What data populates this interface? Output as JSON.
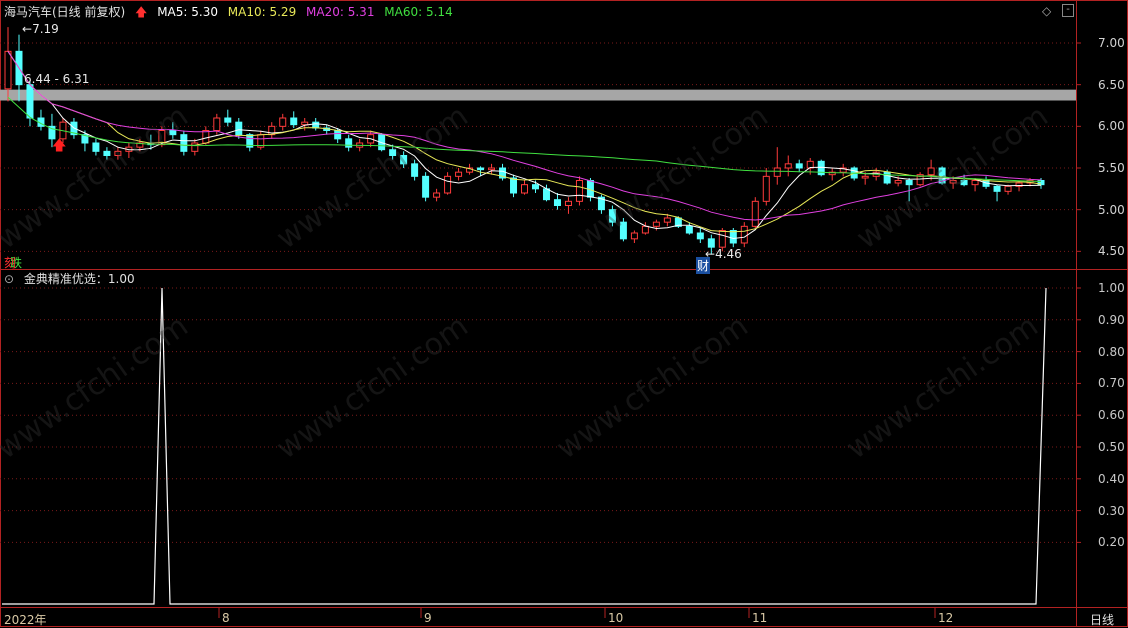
{
  "header": {
    "stock": "海马汽车(日线 前复权)",
    "ma5": "MA5: 5.30",
    "ma10": "MA10: 5.29",
    "ma20": "MA20: 5.31",
    "ma60": "MA60: 5.14",
    "indicator": "金典精准优选：1.00",
    "period": "日线"
  },
  "annotations": {
    "high": "7.19",
    "band": "6.44 - 6.31",
    "low": "4.46",
    "low_tag": "财",
    "left_tag": "跌"
  },
  "watermark": "www.cfchi.com",
  "chart_data": [
    {
      "type": "candlestick",
      "title": "海马汽车(日线 前复权)",
      "y_ticks": [
        "7.00",
        "6.50",
        "6.00",
        "5.50",
        "5.00",
        "4.50"
      ],
      "ylim": [
        4.3,
        7.3
      ],
      "x_ticks": [
        "2022年",
        "8",
        "9",
        "10",
        "11",
        "12"
      ],
      "support_band": [
        6.31,
        6.44
      ],
      "series": [
        {
          "name": "MA5",
          "color": "#ffffff"
        },
        {
          "name": "MA10",
          "color": "#e8e858"
        },
        {
          "name": "MA20",
          "color": "#e040e0"
        },
        {
          "name": "MA60",
          "color": "#40e040"
        }
      ],
      "candles": [
        [
          6.45,
          7.19,
          6.3,
          6.9
        ],
        [
          6.9,
          7.1,
          6.3,
          6.5
        ],
        [
          6.5,
          6.55,
          6.0,
          6.1
        ],
        [
          6.1,
          6.2,
          5.95,
          6.0
        ],
        [
          6.0,
          6.15,
          5.75,
          5.85
        ],
        [
          5.85,
          6.1,
          5.8,
          6.05
        ],
        [
          6.05,
          6.1,
          5.85,
          5.9
        ],
        [
          5.9,
          5.95,
          5.7,
          5.8
        ],
        [
          5.8,
          5.85,
          5.65,
          5.7
        ],
        [
          5.7,
          5.75,
          5.6,
          5.65
        ],
        [
          5.65,
          5.75,
          5.6,
          5.7
        ],
        [
          5.7,
          5.8,
          5.62,
          5.75
        ],
        [
          5.75,
          5.85,
          5.7,
          5.8
        ],
        [
          5.8,
          5.9,
          5.72,
          5.78
        ],
        [
          5.78,
          6.0,
          5.75,
          5.95
        ],
        [
          5.95,
          6.05,
          5.85,
          5.9
        ],
        [
          5.9,
          5.95,
          5.65,
          5.7
        ],
        [
          5.7,
          5.85,
          5.65,
          5.8
        ],
        [
          5.8,
          6.0,
          5.78,
          5.95
        ],
        [
          5.95,
          6.15,
          5.9,
          6.1
        ],
        [
          6.1,
          6.2,
          6.0,
          6.05
        ],
        [
          6.05,
          6.1,
          5.85,
          5.9
        ],
        [
          5.9,
          5.92,
          5.7,
          5.75
        ],
        [
          5.75,
          5.95,
          5.72,
          5.9
        ],
        [
          5.9,
          6.05,
          5.85,
          6.0
        ],
        [
          6.0,
          6.15,
          5.95,
          6.1
        ],
        [
          6.1,
          6.18,
          5.98,
          6.02
        ],
        [
          6.02,
          6.1,
          5.95,
          6.05
        ],
        [
          6.05,
          6.1,
          5.95,
          5.98
        ],
        [
          5.98,
          6.02,
          5.9,
          5.95
        ],
        [
          5.95,
          5.98,
          5.8,
          5.85
        ],
        [
          5.85,
          5.9,
          5.7,
          5.75
        ],
        [
          5.75,
          5.85,
          5.7,
          5.8
        ],
        [
          5.8,
          5.95,
          5.75,
          5.9
        ],
        [
          5.9,
          5.92,
          5.7,
          5.72
        ],
        [
          5.72,
          5.78,
          5.6,
          5.65
        ],
        [
          5.65,
          5.7,
          5.5,
          5.55
        ],
        [
          5.55,
          5.6,
          5.35,
          5.4
        ],
        [
          5.4,
          5.45,
          5.1,
          5.15
        ],
        [
          5.15,
          5.25,
          5.1,
          5.2
        ],
        [
          5.2,
          5.45,
          5.18,
          5.4
        ],
        [
          5.4,
          5.5,
          5.35,
          5.45
        ],
        [
          5.45,
          5.55,
          5.42,
          5.5
        ],
        [
          5.5,
          5.52,
          5.4,
          5.48
        ],
        [
          5.48,
          5.55,
          5.42,
          5.5
        ],
        [
          5.5,
          5.55,
          5.35,
          5.38
        ],
        [
          5.38,
          5.42,
          5.15,
          5.2
        ],
        [
          5.2,
          5.35,
          5.18,
          5.3
        ],
        [
          5.3,
          5.35,
          5.2,
          5.25
        ],
        [
          5.25,
          5.3,
          5.1,
          5.12
        ],
        [
          5.12,
          5.2,
          5.0,
          5.05
        ],
        [
          5.05,
          5.15,
          4.95,
          5.1
        ],
        [
          5.1,
          5.4,
          5.05,
          5.35
        ],
        [
          5.35,
          5.38,
          5.1,
          5.15
        ],
        [
          5.15,
          5.18,
          4.95,
          5.0
        ],
        [
          5.0,
          5.05,
          4.8,
          4.85
        ],
        [
          4.85,
          4.9,
          4.62,
          4.65
        ],
        [
          4.65,
          4.75,
          4.6,
          4.72
        ],
        [
          4.72,
          4.85,
          4.7,
          4.8
        ],
        [
          4.8,
          4.88,
          4.75,
          4.85
        ],
        [
          4.85,
          4.95,
          4.8,
          4.9
        ],
        [
          4.9,
          4.92,
          4.78,
          4.8
        ],
        [
          4.8,
          4.85,
          4.7,
          4.72
        ],
        [
          4.72,
          4.78,
          4.6,
          4.65
        ],
        [
          4.65,
          4.7,
          4.46,
          4.55
        ],
        [
          4.55,
          4.78,
          4.5,
          4.75
        ],
        [
          4.75,
          4.78,
          4.55,
          4.6
        ],
        [
          4.6,
          4.85,
          4.55,
          4.8
        ],
        [
          4.8,
          5.15,
          4.78,
          5.1
        ],
        [
          5.1,
          5.5,
          5.05,
          5.4
        ],
        [
          5.4,
          5.75,
          5.3,
          5.5
        ],
        [
          5.5,
          5.65,
          5.4,
          5.55
        ],
        [
          5.55,
          5.6,
          5.45,
          5.5
        ],
        [
          5.5,
          5.62,
          5.42,
          5.58
        ],
        [
          5.58,
          5.6,
          5.4,
          5.42
        ],
        [
          5.42,
          5.5,
          5.35,
          5.45
        ],
        [
          5.45,
          5.55,
          5.4,
          5.5
        ],
        [
          5.5,
          5.52,
          5.35,
          5.38
        ],
        [
          5.38,
          5.45,
          5.3,
          5.4
        ],
        [
          5.4,
          5.5,
          5.35,
          5.45
        ],
        [
          5.45,
          5.48,
          5.3,
          5.32
        ],
        [
          5.32,
          5.4,
          5.28,
          5.35
        ],
        [
          5.35,
          5.38,
          5.1,
          5.3
        ],
        [
          5.3,
          5.45,
          5.28,
          5.42
        ],
        [
          5.42,
          5.6,
          5.35,
          5.5
        ],
        [
          5.5,
          5.52,
          5.3,
          5.32
        ],
        [
          5.32,
          5.4,
          5.25,
          5.35
        ],
        [
          5.35,
          5.42,
          5.28,
          5.3
        ],
        [
          5.3,
          5.38,
          5.22,
          5.35
        ],
        [
          5.35,
          5.4,
          5.25,
          5.28
        ],
        [
          5.28,
          5.3,
          5.1,
          5.22
        ],
        [
          5.22,
          5.3,
          5.18,
          5.28
        ],
        [
          5.28,
          5.35,
          5.22,
          5.32
        ],
        [
          5.32,
          5.38,
          5.28,
          5.35
        ],
        [
          5.35,
          5.38,
          5.25,
          5.3
        ]
      ]
    },
    {
      "type": "line",
      "title": "金典精准优选",
      "value": 1.0,
      "y_ticks": [
        "1.00",
        "0.90",
        "0.80",
        "0.70",
        "0.60",
        "0.50",
        "0.40",
        "0.30",
        "0.20"
      ],
      "ylim": [
        0,
        1.0
      ],
      "signal_indices": [
        17,
        112
      ]
    }
  ]
}
